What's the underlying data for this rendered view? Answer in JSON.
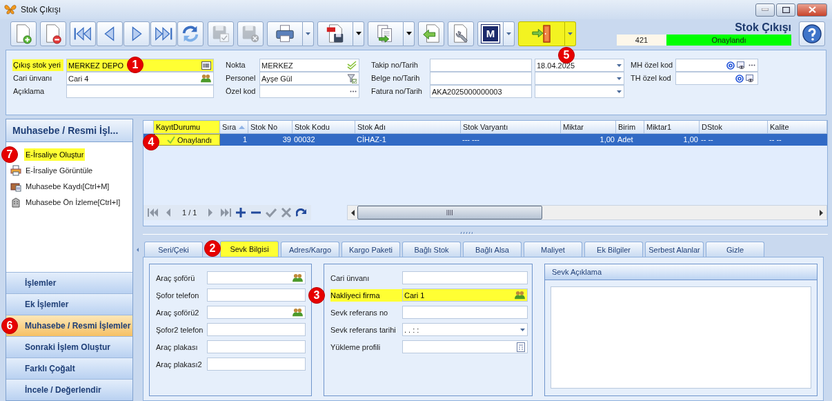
{
  "window": {
    "title": "Stok Çıkışı"
  },
  "toolbar": {
    "groups": [
      {
        "buttons": [
          {
            "kind": "new",
            "disabled": false,
            "dropdown": false,
            "highlighted": false
          }
        ]
      },
      {
        "buttons": [
          {
            "kind": "delete",
            "disabled": false,
            "dropdown": false,
            "highlighted": false
          }
        ]
      },
      {
        "buttons": [
          {
            "kind": "first",
            "disabled": false,
            "dropdown": false,
            "highlighted": false
          },
          {
            "kind": "previous",
            "disabled": false,
            "dropdown": false,
            "highlighted": false
          },
          {
            "kind": "next",
            "disabled": false,
            "dropdown": false,
            "highlighted": false
          },
          {
            "kind": "last",
            "disabled": false,
            "dropdown": false,
            "highlighted": false
          },
          {
            "kind": "refresh",
            "disabled": false,
            "dropdown": false,
            "highlighted": false
          }
        ]
      },
      {
        "buttons": [
          {
            "kind": "save",
            "disabled": true,
            "dropdown": false,
            "highlighted": false
          }
        ]
      },
      {
        "buttons": [
          {
            "kind": "cancel",
            "disabled": true,
            "dropdown": false,
            "highlighted": false
          }
        ]
      },
      {
        "buttons": [
          {
            "kind": "print",
            "disabled": false,
            "dropdown": true,
            "highlighted": false
          }
        ]
      },
      {
        "buttons": [
          {
            "kind": "pdf",
            "disabled": false,
            "dropdown": true,
            "highlighted": false
          }
        ]
      },
      {
        "buttons": [
          {
            "kind": "copy",
            "disabled": false,
            "dropdown": true,
            "highlighted": false
          }
        ]
      },
      {
        "buttons": [
          {
            "kind": "import",
            "disabled": false,
            "dropdown": false,
            "highlighted": false
          }
        ]
      },
      {
        "buttons": [
          {
            "kind": "settings",
            "disabled": false,
            "dropdown": false,
            "highlighted": false
          }
        ]
      },
      {
        "buttons": [
          {
            "kind": "letter",
            "label": "M",
            "disabled": false,
            "dropdown": true,
            "highlighted": false
          }
        ]
      },
      {
        "buttons": [
          {
            "kind": "exit",
            "disabled": false,
            "dropdown": true,
            "highlighted": true,
            "callout": "5"
          }
        ]
      }
    ]
  },
  "document": {
    "title": "Stok Çıkışı",
    "number": "421",
    "status": "Onaylandı"
  },
  "header": {
    "columns": [
      {
        "rows": [
          {
            "label": "Çıkış stok yeri",
            "highlighted": true,
            "callout": "1",
            "fields": [
              {
                "kind": "stock-place",
                "value": "MERKEZ DEPO"
              }
            ]
          },
          {
            "label": "Cari ünvanı",
            "highlighted": false,
            "fields": [
              {
                "kind": "account",
                "value": "Cari 4"
              }
            ]
          },
          {
            "label": "Açıklama",
            "highlighted": false,
            "fields": [
              {
                "kind": "text"
              }
            ]
          }
        ]
      },
      {
        "rows": [
          {
            "label": "Nokta",
            "highlighted": false,
            "fields": [
              {
                "kind": "point",
                "value": "MERKEZ"
              }
            ]
          },
          {
            "label": "Personel",
            "highlighted": false,
            "fields": [
              {
                "kind": "staff",
                "value": "Ayşe Gül"
              }
            ]
          },
          {
            "label": "Özel kod",
            "highlighted": false,
            "fields": [
              {
                "kind": "code"
              }
            ]
          }
        ]
      },
      {
        "rows": [
          {
            "label": "Takip no/Tarih",
            "highlighted": false,
            "fields": [
              {
                "kind": "text"
              },
              {
                "kind": "dropdown",
                "value": "18.04.2025"
              }
            ]
          },
          {
            "label": "Belge no/Tarih",
            "highlighted": false,
            "fields": [
              {
                "kind": "text"
              },
              {
                "kind": "dropdown"
              }
            ]
          },
          {
            "label": "Fatura no/Tarih",
            "highlighted": false,
            "fields": [
              {
                "kind": "text",
                "value": "AKA2025000000003"
              },
              {
                "kind": "dropdown"
              }
            ]
          }
        ]
      },
      {
        "rows": [
          {
            "label": "MH özel kod",
            "highlighted": false,
            "fields": [
              {
                "kind": "codes"
              }
            ]
          },
          {
            "label": "TH özel kod",
            "highlighted": false,
            "fields": [
              {
                "kind": "codes-short"
              }
            ]
          }
        ]
      }
    ]
  },
  "sidebar": {
    "title": "Muhasebe / Resmi İşl...",
    "items": [
      {
        "kind": "create",
        "label": "E-İrsaliye Oluştur",
        "highlighted": true,
        "callout": "7"
      },
      {
        "kind": "view",
        "label": "E-İrsaliye Görüntüle",
        "highlighted": false
      },
      {
        "kind": "record",
        "label": "Muhasebe Kaydı[Ctrl+M]",
        "highlighted": false
      },
      {
        "kind": "preview",
        "label": "Muhasebe Ön İzleme[Ctrl+I]",
        "highlighted": false
      }
    ],
    "sections": [
      {
        "label": "İşlemler",
        "selected": false
      },
      {
        "label": "Ek İşlemler",
        "selected": false
      },
      {
        "label": "Muhasebe / Resmi İşlemler",
        "selected": true,
        "callout": "6"
      },
      {
        "label": "Sonraki İşlem Oluştur",
        "selected": false
      },
      {
        "label": "Farklı Çoğalt",
        "selected": false
      },
      {
        "label": "İncele / Değerlendir",
        "selected": false
      }
    ]
  },
  "grid": {
    "columns": [
      {
        "label": "KayıtDurumu",
        "highlighted": true,
        "sorted": false
      },
      {
        "label": "Sıra",
        "highlighted": false,
        "sorted": true
      },
      {
        "label": "Stok No",
        "highlighted": false,
        "sorted": false
      },
      {
        "label": "Stok Kodu",
        "highlighted": false,
        "sorted": false
      },
      {
        "label": "Stok Adı",
        "highlighted": false,
        "sorted": false
      },
      {
        "label": "Stok Varyantı",
        "highlighted": false,
        "sorted": false
      },
      {
        "label": "Miktar",
        "highlighted": false,
        "sorted": false
      },
      {
        "label": "Birim",
        "highlighted": false,
        "sorted": false
      },
      {
        "label": "Miktar1",
        "highlighted": false,
        "sorted": false
      },
      {
        "label": "DStok",
        "highlighted": false,
        "sorted": false
      },
      {
        "label": "Kalite",
        "highlighted": false,
        "sorted": false
      }
    ],
    "rows": [
      {
        "selected": true,
        "callout": "4",
        "cells": [
          "Onaylandı",
          "1",
          "39",
          "00032",
          "CİHAZ-1",
          "--- ---",
          "1,00",
          "Adet",
          "1,00",
          "-- --",
          "-- --"
        ]
      }
    ],
    "navigator": {
      "page": "1 / 1"
    }
  },
  "tabs": [
    {
      "label": "Seri/Çeki",
      "selected": false,
      "highlighted": false
    },
    {
      "label": "Sevk Bilgisi",
      "selected": true,
      "highlighted": true,
      "callout": "2"
    },
    {
      "label": "Adres/Kargo",
      "selected": false,
      "highlighted": false
    },
    {
      "label": "Kargo Paketi",
      "selected": false,
      "highlighted": false
    },
    {
      "label": "Bağlı Stok",
      "selected": false,
      "highlighted": false
    },
    {
      "label": "Bağlı Alsa",
      "selected": false,
      "highlighted": false
    },
    {
      "label": "Maliyet",
      "selected": false,
      "highlighted": false
    },
    {
      "label": "Ek Bilgiler",
      "selected": false,
      "highlighted": false
    },
    {
      "label": "Serbest Alanlar",
      "selected": false,
      "highlighted": false
    },
    {
      "label": "Gizle",
      "selected": false,
      "highlighted": false
    }
  ],
  "shipment": {
    "groups": [
      {
        "rows": [
          {
            "label": "Araç şoförü",
            "kind": "account",
            "highlighted": false
          },
          {
            "label": "Şofor telefon",
            "kind": "text",
            "highlighted": false
          },
          {
            "label": "Araç şoförü2",
            "kind": "account",
            "highlighted": false
          },
          {
            "label": "Şofor2 telefon",
            "kind": "text",
            "highlighted": false
          },
          {
            "label": "Araç plakası",
            "kind": "text",
            "highlighted": false
          },
          {
            "label": "Araç plakası2",
            "kind": "text",
            "highlighted": false
          }
        ]
      },
      {
        "rows": [
          {
            "label": "Cari ünvanı",
            "kind": "text",
            "highlighted": false
          },
          {
            "label": "Nakliyeci firma",
            "kind": "account",
            "value": "Cari 1",
            "highlighted": true,
            "callout": "3"
          },
          {
            "label": "Sevk referans no",
            "kind": "text",
            "highlighted": false
          },
          {
            "label": "Sevk referans tarihi",
            "kind": "dropdown",
            "value": ".  .      :  :",
            "highlighted": false
          },
          {
            "label": "Yükleme profili",
            "kind": "profile",
            "highlighted": false
          }
        ]
      }
    ],
    "note_panel": {
      "title": "Sevk Açıklama"
    }
  }
}
